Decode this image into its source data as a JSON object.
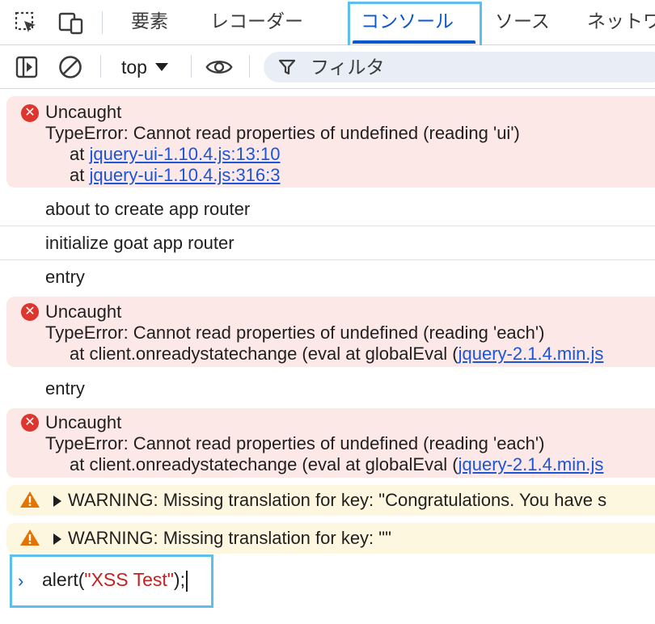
{
  "tabs": [
    {
      "label": "要素"
    },
    {
      "label": "レコーダー"
    },
    {
      "label": "コンソール"
    },
    {
      "label": "ソース"
    },
    {
      "label": "ネットワ"
    }
  ],
  "toolbar": {
    "context": "top",
    "filter_placeholder": "フィルタ"
  },
  "messages": [
    {
      "level": "error",
      "title": "Uncaught",
      "text": "TypeError: Cannot read properties of undefined (reading 'ui')",
      "stack": [
        {
          "prefix": "at ",
          "link": "jquery-ui-1.10.4.js:13:10"
        },
        {
          "prefix": "at ",
          "link": "jquery-ui-1.10.4.js:316:3"
        }
      ]
    },
    {
      "level": "log",
      "text": "about to create app router"
    },
    {
      "level": "log",
      "text": "initialize goat app router"
    },
    {
      "level": "log",
      "text": "entry"
    },
    {
      "level": "error",
      "title": "Uncaught",
      "text": "TypeError: Cannot read properties of undefined (reading 'each')",
      "stack": [
        {
          "prefix": "at client.onreadystatechange (eval at globalEval (",
          "link": "jquery-2.1.4.min.js"
        }
      ]
    },
    {
      "level": "log",
      "text": "entry"
    },
    {
      "level": "error",
      "title": "Uncaught",
      "text": "TypeError: Cannot read properties of undefined (reading 'each')",
      "stack": [
        {
          "prefix": "at client.onreadystatechange (eval at globalEval (",
          "link": "jquery-2.1.4.min.js"
        }
      ]
    },
    {
      "level": "warning",
      "text": "WARNING: Missing translation for key: \"Congratulations. You have s"
    },
    {
      "level": "warning",
      "text": "WARNING: Missing translation for key: \"\""
    }
  ],
  "prompt": {
    "prefix": "alert(",
    "string": "\"XSS Test\"",
    "suffix": ");"
  },
  "colors": {
    "accent": "#0b57d0",
    "error_bg": "#fce8e6",
    "warning_bg": "#fef7e0",
    "highlight": "#5bc0eb"
  }
}
